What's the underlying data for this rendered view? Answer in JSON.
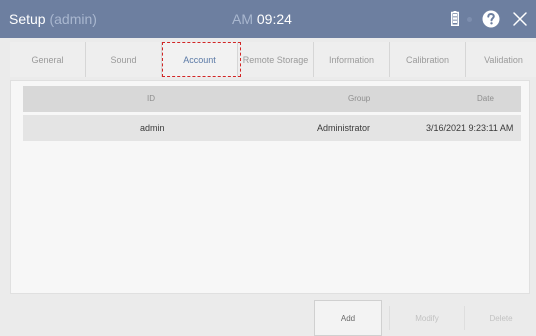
{
  "header": {
    "title": "Setup",
    "user": "(admin)",
    "ampm": "AM",
    "time": "09:24"
  },
  "tabs": [
    {
      "label": "General"
    },
    {
      "label": "Sound"
    },
    {
      "label": "Account",
      "active": true
    },
    {
      "label": "Remote Storage"
    },
    {
      "label": "Information"
    },
    {
      "label": "Calibration"
    },
    {
      "label": "Validation"
    }
  ],
  "table": {
    "columns": {
      "id": "ID",
      "group": "Group",
      "date": "Date"
    },
    "rows": [
      {
        "id": "admin",
        "group": "Administrator",
        "date": "3/16/2021 9:23:11 AM"
      }
    ]
  },
  "footer": {
    "add_label": "Add",
    "modify_label": "Modify",
    "delete_label": "Delete"
  },
  "icons": {
    "battery": "battery-icon",
    "help": "help-icon",
    "close": "close-icon"
  },
  "colors": {
    "titlebar": "#6d7fa0",
    "active_tab_text": "#5a79a6",
    "highlight": "#d22525"
  }
}
